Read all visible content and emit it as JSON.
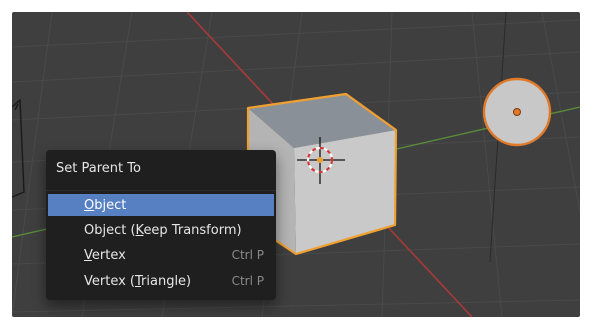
{
  "menu": {
    "title": "Set Parent To",
    "items": [
      {
        "pre": "",
        "u": "O",
        "post": "bject",
        "shortcut": "",
        "active": true
      },
      {
        "pre": "Object (",
        "u": "K",
        "post": "eep Transform)",
        "shortcut": "",
        "active": false
      },
      {
        "pre": "",
        "u": "V",
        "post": "ertex",
        "shortcut": "Ctrl P",
        "active": false
      },
      {
        "pre": "Vertex (",
        "u": "T",
        "post": "riangle)",
        "shortcut": "Ctrl P",
        "active": false
      }
    ]
  },
  "colors": {
    "viewport_bg": "#3f3f3f",
    "selection_outline": "#f0a030",
    "active_item": "#5680c2",
    "x_axis": "#a83a3a",
    "y_axis": "#5a8a3a"
  }
}
